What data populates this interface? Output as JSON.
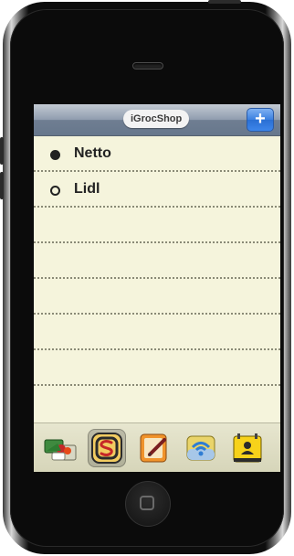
{
  "navbar": {
    "title": "iGrocShop",
    "add_label": "+"
  },
  "shops": [
    {
      "name": "Netto",
      "state": "selected"
    },
    {
      "name": "Lidl",
      "state": "unselected"
    }
  ],
  "tabs": [
    {
      "name": "shopping-basket-icon",
      "selected": false
    },
    {
      "name": "shops-s-icon",
      "selected": true
    },
    {
      "name": "notepad-edit-icon",
      "selected": false
    },
    {
      "name": "wifi-sync-icon",
      "selected": false
    },
    {
      "name": "contact-card-icon",
      "selected": false
    }
  ],
  "colors": {
    "paper": "#f5f4dc",
    "navbar": "#7f8ea2",
    "accent_blue": "#3a7fe0"
  }
}
